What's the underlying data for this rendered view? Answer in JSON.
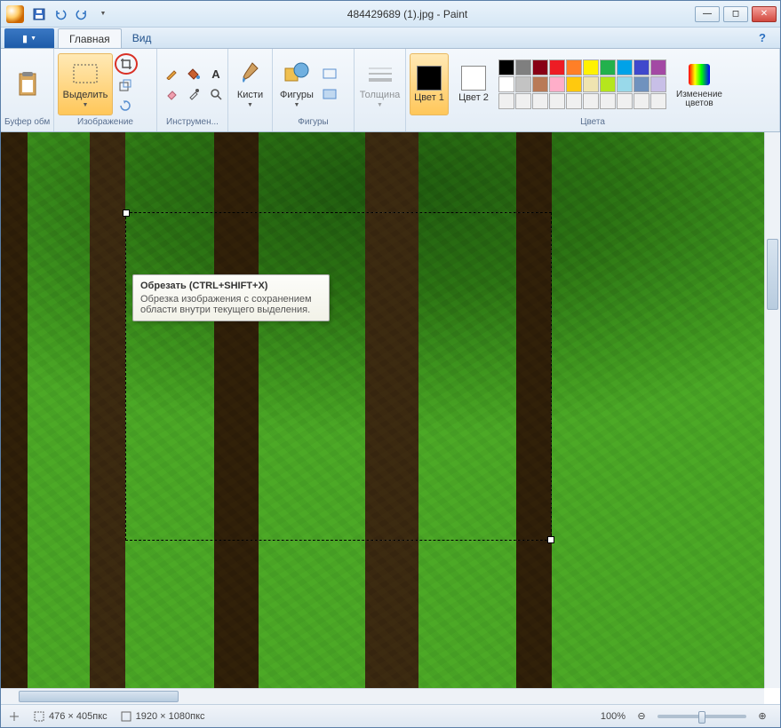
{
  "title": "484429689 (1).jpg - Paint",
  "tabs": {
    "file": "▾",
    "home": "Главная",
    "view": "Вид"
  },
  "ribbon": {
    "clipboard": {
      "label": "Буфер обмена",
      "paste": "Вста-вить"
    },
    "image": {
      "label": "Изображение",
      "select": "Выделить"
    },
    "tools": {
      "label": "Инструмен..."
    },
    "brushes": {
      "label": "Кисти",
      "name": "Кисти"
    },
    "shapes": {
      "label": "Фигуры",
      "name": "Фигуры"
    },
    "thickness": {
      "label": "",
      "name": "Толщина"
    },
    "colors": {
      "label": "Цвета",
      "c1": "Цвет 1",
      "c2": "Цвет 2",
      "edit": "Изменение цветов"
    },
    "palette": [
      "#000",
      "#7f7f7f",
      "#880015",
      "#ed1c24",
      "#ff7f27",
      "#fff200",
      "#22b14c",
      "#00a2e8",
      "#3f48cc",
      "#a349a4",
      "#fff",
      "#c3c3c3",
      "#b97a57",
      "#ffaec9",
      "#ffc90e",
      "#efe4b0",
      "#b5e61d",
      "#99d9ea",
      "#7092be",
      "#c8bfe7",
      "#f0f0f0",
      "#f0f0f0",
      "#f0f0f0",
      "#f0f0f0",
      "#f0f0f0",
      "#f0f0f0",
      "#f0f0f0",
      "#f0f0f0",
      "#f0f0f0",
      "#f0f0f0"
    ]
  },
  "tooltip": {
    "title": "Обрезать (CTRL+SHIFT+X)",
    "body": "Обрезка изображения с сохранением области внутри текущего выделения."
  },
  "status": {
    "selection": "476 × 405пкс",
    "canvas": "1920 × 1080пкс",
    "zoom": "100%"
  }
}
